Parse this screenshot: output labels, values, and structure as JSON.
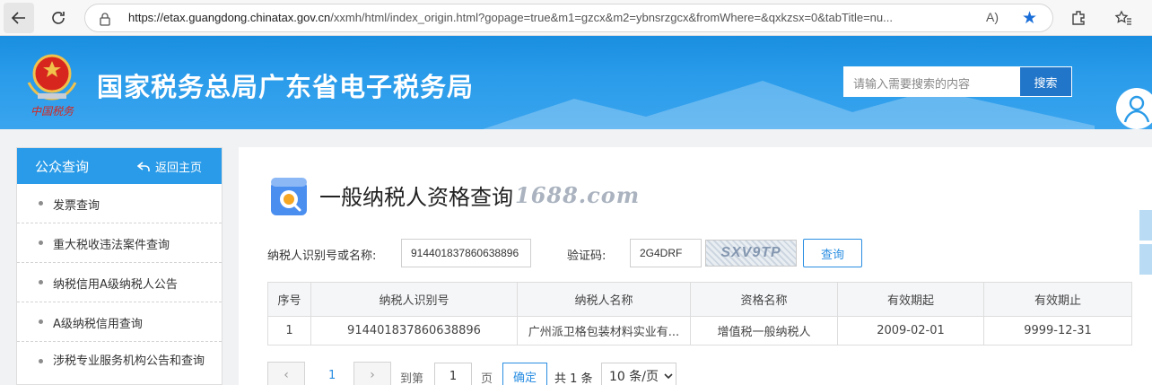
{
  "browser": {
    "url_host": "https://etax.guangdong.chinatax.gov.cn",
    "url_path": "/xxmh/html/index_origin.html?gopage=true&m1=gzcx&m2=ybnsrzgcx&fromWhere=&qxkzsx=0&tabTitle=nu...",
    "read_aloud": "A)"
  },
  "header": {
    "site_title": "国家税务总局广东省电子税务局",
    "emblem_caption": "中国税务",
    "search_placeholder": "请输入需要搜索的内容",
    "search_button": "搜索",
    "login_label": "登录"
  },
  "sidebar": {
    "title": "公众查询",
    "back_label": "返回主页",
    "items": [
      {
        "label": "发票查询"
      },
      {
        "label": "重大税收违法案件查询"
      },
      {
        "label": "纳税信用A级纳税人公告"
      },
      {
        "label": "A级纳税信用查询"
      },
      {
        "label": "涉税专业服务机构公告和查询"
      }
    ]
  },
  "main": {
    "title": "一般纳税人资格查询",
    "watermark": "1688.com",
    "taxpayer_label": "纳税人识别号或名称:",
    "taxpayer_value": "914401837860638896",
    "captcha_label": "验证码:",
    "captcha_value": "2G4DRF",
    "captcha_image_text": "SXV9TP",
    "query_button": "查询"
  },
  "table": {
    "headers": [
      "序号",
      "纳税人识别号",
      "纳税人名称",
      "资格名称",
      "有效期起",
      "有效期止"
    ],
    "rows": [
      [
        "1",
        "914401837860638896",
        "广州派卫格包装材料实业有...",
        "增值税一般纳税人",
        "2009-02-01",
        "9999-12-31"
      ]
    ]
  },
  "pager": {
    "prev": "‹",
    "current_page": "1",
    "next": "›",
    "goto_prefix": "到第",
    "goto_value": "1",
    "goto_suffix": "页",
    "confirm": "确定",
    "total": "共 1 条",
    "page_size": "10 条/页"
  }
}
